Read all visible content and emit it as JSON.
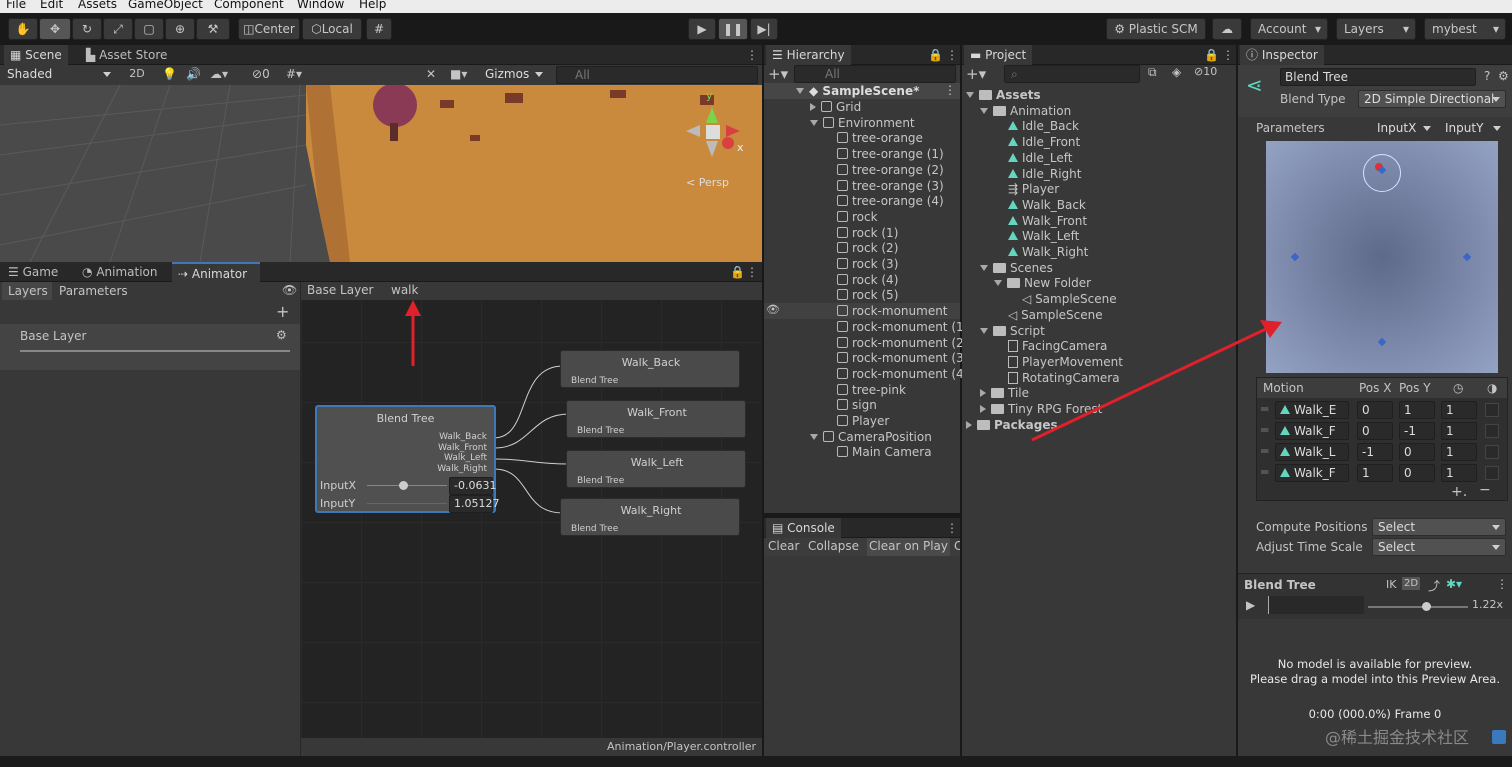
{
  "menu": [
    "File",
    "Edit",
    "Assets",
    "GameObject",
    "Component",
    "Window",
    "Help"
  ],
  "toolbar": {
    "center": "Center",
    "local": "Local",
    "plastic": "Plastic SCM",
    "account": "Account",
    "layers": "Layers",
    "layout": "mybest"
  },
  "scene": {
    "tab_scene": "Scene",
    "tab_store": "Asset Store",
    "shading": "Shaded",
    "mode_2d": "2D",
    "hidden_count": "0",
    "gizmos": "Gizmos",
    "search_placeholder": "All",
    "persp": "Persp",
    "axis_x": "x",
    "axis_y": "y"
  },
  "animator": {
    "tabs": [
      "Game",
      "Animation",
      "Animator"
    ],
    "left_tabs": [
      "Layers",
      "Parameters"
    ],
    "layer_name": "Base Layer",
    "breadcrumb_base": "Base Layer",
    "breadcrumb_current": "walk",
    "footer": "Animation/Player.controller",
    "blend_node": {
      "title": "Blend Tree",
      "outputs": [
        "Walk_Back",
        "Walk_Front",
        "Walk_Left",
        "Walk_Right"
      ],
      "param_x": "InputX",
      "param_x_value": "-0.0631",
      "param_y": "InputY",
      "param_y_value": "1.05127"
    },
    "motion_nodes": [
      {
        "title": "Walk_Back",
        "sub": "Blend Tree"
      },
      {
        "title": "Walk_Front",
        "sub": "Blend Tree"
      },
      {
        "title": "Walk_Left",
        "sub": "Blend Tree"
      },
      {
        "title": "Walk_Right",
        "sub": "Blend Tree"
      }
    ]
  },
  "hierarchy": {
    "title": "Hierarchy",
    "search_placeholder": "All",
    "scene": "SampleScene*",
    "items": [
      "Grid",
      "Environment",
      "tree-orange",
      "tree-orange (1)",
      "tree-orange (2)",
      "tree-orange (3)",
      "tree-orange (4)",
      "rock",
      "rock (1)",
      "rock (2)",
      "rock (3)",
      "rock (4)",
      "rock (5)",
      "rock-monument",
      "rock-monument (1",
      "rock-monument (2",
      "rock-monument (3",
      "rock-monument (4",
      "tree-pink",
      "sign",
      "Player",
      "CameraPosition",
      "Main Camera"
    ]
  },
  "console": {
    "title": "Console",
    "buttons": [
      "Clear",
      "Collapse",
      "Clear on Play",
      "C"
    ]
  },
  "project": {
    "title": "Project",
    "hidden_count": "10",
    "items": [
      "Assets",
      "Animation",
      "Idle_Back",
      "Idle_Front",
      "Idle_Left",
      "Idle_Right",
      "Player",
      "Walk_Back",
      "Walk_Front",
      "Walk_Left",
      "Walk_Right",
      "Scenes",
      "New Folder",
      "SampleScene",
      "SampleScene",
      "Script",
      "FacingCamera",
      "PlayerMovement",
      "RotatingCamera",
      "Tile",
      "Tiny RPG Forest",
      "Packages"
    ]
  },
  "inspector": {
    "title": "Inspector",
    "name": "Blend Tree",
    "blend_type_label": "Blend Type",
    "blend_type": "2D Simple Directional",
    "parameters_label": "Parameters",
    "param_x": "InputX",
    "param_y": "InputY",
    "motion_header": [
      "Motion",
      "Pos X",
      "Pos Y"
    ],
    "motions": [
      {
        "name": "Walk_E",
        "x": "0",
        "y": "1",
        "speed": "1"
      },
      {
        "name": "Walk_F",
        "x": "0",
        "y": "-1",
        "speed": "1"
      },
      {
        "name": "Walk_L",
        "x": "-1",
        "y": "0",
        "speed": "1"
      },
      {
        "name": "Walk_F",
        "x": "1",
        "y": "0",
        "speed": "1"
      }
    ],
    "compute_label": "Compute Positions",
    "compute_value": "Select",
    "adjust_label": "Adjust Time Scale",
    "adjust_value": "Select",
    "preview_title": "Blend Tree",
    "preview_ik": "IK",
    "preview_2d": "2D",
    "preview_speed": "1.22x",
    "preview_msg1": "No model is available for preview.",
    "preview_msg2": "Please drag a model into this Preview Area.",
    "preview_time": "0:00 (000.0%) Frame 0"
  },
  "watermark": "@稀土掘金技术社区",
  "colors": {
    "accent": "#3a79bb",
    "annotation": "#e0202a",
    "anim_icon": "#63d6c0",
    "sand": "#c98a3e"
  }
}
